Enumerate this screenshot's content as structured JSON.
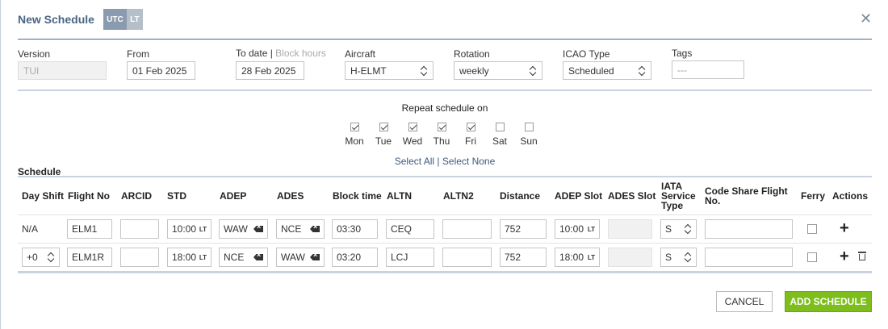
{
  "header": {
    "title": "New Schedule",
    "tz_utc": "UTC",
    "tz_lt": "LT",
    "close_icon": "close-icon"
  },
  "fields": {
    "version": {
      "label": "Version",
      "value": "TUI"
    },
    "from": {
      "label": "From",
      "value": "01 Feb 2025"
    },
    "to_date": {
      "label": "To date",
      "sep": " | ",
      "alt_label": "Block hours",
      "value": "28 Feb 2025"
    },
    "aircraft": {
      "label": "Aircraft",
      "value": "H-ELMT"
    },
    "rotation": {
      "label": "Rotation",
      "value": "weekly"
    },
    "icao_type": {
      "label": "ICAO Type",
      "value": "Scheduled"
    },
    "tags": {
      "label": "Tags",
      "placeholder": "---"
    }
  },
  "repeat": {
    "title": "Repeat schedule on",
    "days": [
      {
        "label": "Mon",
        "checked": true
      },
      {
        "label": "Tue",
        "checked": true
      },
      {
        "label": "Wed",
        "checked": true
      },
      {
        "label": "Thu",
        "checked": true
      },
      {
        "label": "Fri",
        "checked": true
      },
      {
        "label": "Sat",
        "checked": false
      },
      {
        "label": "Sun",
        "checked": false
      }
    ],
    "select_all": "Select All",
    "select_sep": " | ",
    "select_none": "Select None"
  },
  "schedule": {
    "title": "Schedule",
    "columns": {
      "day_shift": "Day Shift",
      "flight_no": "Flight No",
      "arcid": "ARCID",
      "std": "STD",
      "adep": "ADEP",
      "ades": "ADES",
      "block_time": "Block time",
      "altn": "ALTN",
      "altn2": "ALTN2",
      "distance": "Distance",
      "adep_slot": "ADEP Slot",
      "ades_slot": "ADES Slot",
      "iata_1": "IATA",
      "iata_2": "Service",
      "iata_3": "Type",
      "code_share_1": "Code Share Flight",
      "code_share_2": "No.",
      "ferry": "Ferry",
      "actions": "Actions"
    },
    "lt_tag": "LT",
    "rows": [
      {
        "day_shift": "N/A",
        "flight_no": "ELM1",
        "arcid": "",
        "std": "10:00",
        "adep": "WAW",
        "ades": "NCE",
        "block_time": "03:30",
        "altn": "CEQ",
        "altn2": "",
        "distance": "752",
        "adep_slot": "10:00",
        "ades_slot": "",
        "iata": "S",
        "code_share": "",
        "ferry": false
      },
      {
        "day_shift": "+0",
        "flight_no": "ELM1R",
        "arcid": "",
        "std": "18:00",
        "adep": "NCE",
        "ades": "WAW",
        "block_time": "03:20",
        "altn": "LCJ",
        "altn2": "",
        "distance": "752",
        "adep_slot": "18:00",
        "ades_slot": "",
        "iata": "S",
        "code_share": "",
        "ferry": false
      }
    ]
  },
  "footer": {
    "cancel": "CANCEL",
    "add": "ADD SCHEDULE"
  }
}
